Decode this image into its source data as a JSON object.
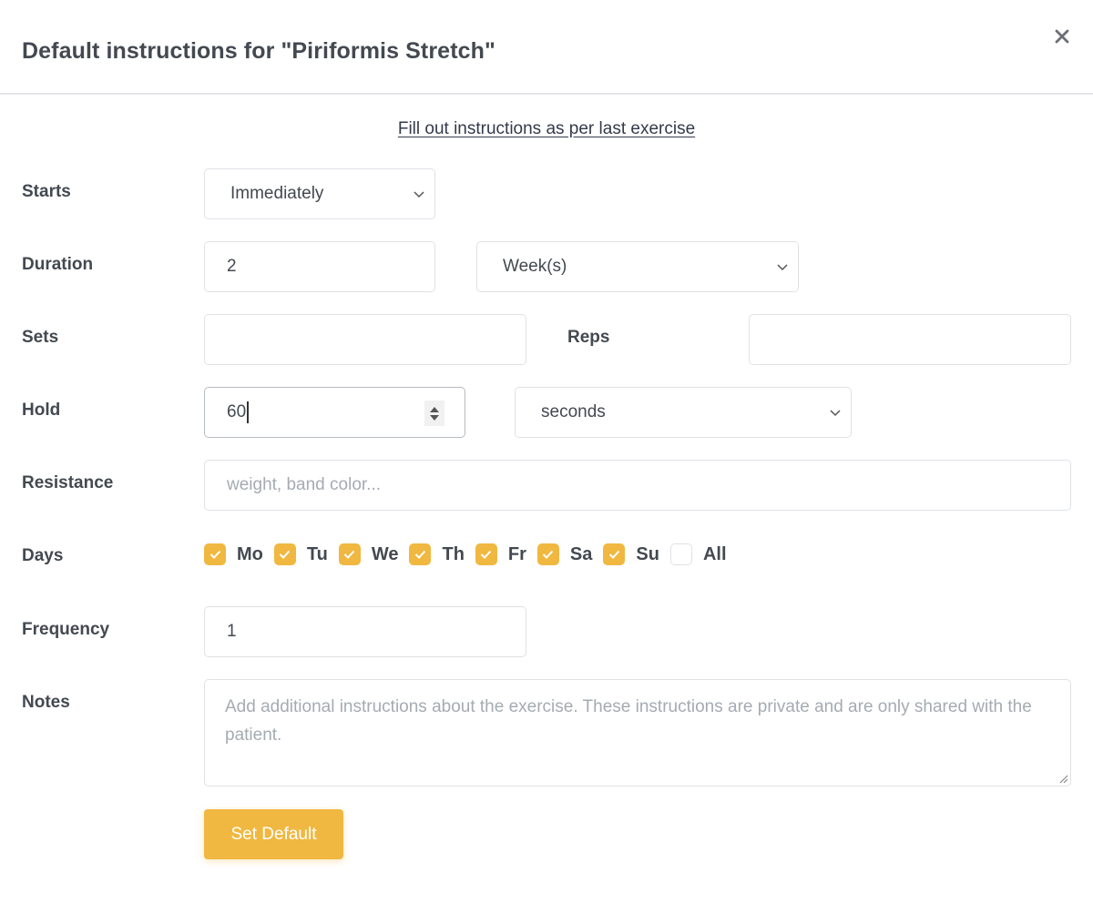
{
  "modal": {
    "title": "Default instructions for \"Piriformis Stretch\"",
    "close_icon": "close-icon"
  },
  "fill_link": "Fill out instructions as per last exercise",
  "form": {
    "starts": {
      "label": "Starts",
      "value": "Immediately"
    },
    "duration": {
      "label": "Duration",
      "value": "2",
      "unit": "Week(s)"
    },
    "sets": {
      "label": "Sets",
      "value": ""
    },
    "reps": {
      "label": "Reps",
      "value": ""
    },
    "hold": {
      "label": "Hold",
      "value": "60",
      "unit": "seconds"
    },
    "resistance": {
      "label": "Resistance",
      "value": "",
      "placeholder": "weight, band color..."
    },
    "days": {
      "label": "Days",
      "items": [
        {
          "label": "Mo",
          "checked": true
        },
        {
          "label": "Tu",
          "checked": true
        },
        {
          "label": "We",
          "checked": true
        },
        {
          "label": "Th",
          "checked": true
        },
        {
          "label": "Fr",
          "checked": true
        },
        {
          "label": "Sa",
          "checked": true
        },
        {
          "label": "Su",
          "checked": true
        },
        {
          "label": "All",
          "checked": false
        }
      ]
    },
    "frequency": {
      "label": "Frequency",
      "value": "1"
    },
    "notes": {
      "label": "Notes",
      "value": "",
      "placeholder": "Add additional instructions about the exercise. These instructions are private and are only shared with the patient."
    }
  },
  "buttons": {
    "set_default": "Set Default"
  },
  "colors": {
    "accent": "#f0b840",
    "text": "#434950",
    "border": "#dfe2e6",
    "placeholder": "#a5abb2"
  }
}
